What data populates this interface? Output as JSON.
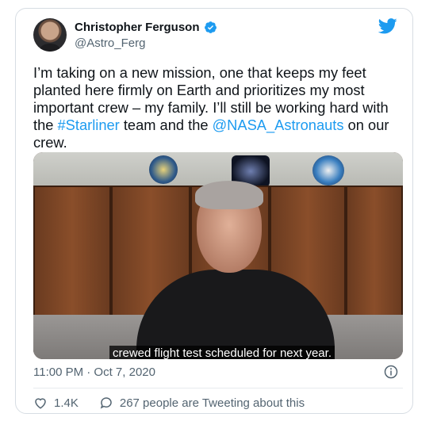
{
  "author": {
    "name": "Christopher Ferguson",
    "handle": "@Astro_Ferg"
  },
  "tweet": {
    "text_1": "I’m taking on a new mission, one that keeps my feet planted here firmly on Earth and prioritizes my most important crew – my family. I’ll still be working hard with the ",
    "hashtag": "#Starliner",
    "text_2": " team and the ",
    "mention": "@NASA_Astronauts",
    "text_3": " on our crew."
  },
  "media": {
    "caption": "crewed flight test scheduled for next year."
  },
  "timestamp": "11:00 PM · Oct 7, 2020",
  "actions": {
    "likes": "1.4K",
    "conversation": "267 people are Tweeting about this"
  },
  "icons": {
    "verified": "verified-badge-icon",
    "brand": "twitter-bird-icon",
    "info": "info-icon",
    "like": "heart-icon",
    "conversation": "speech-bubble-icon"
  },
  "colors": {
    "link": "#1d9bf0",
    "text": "#0f1419",
    "muted": "#536471"
  }
}
